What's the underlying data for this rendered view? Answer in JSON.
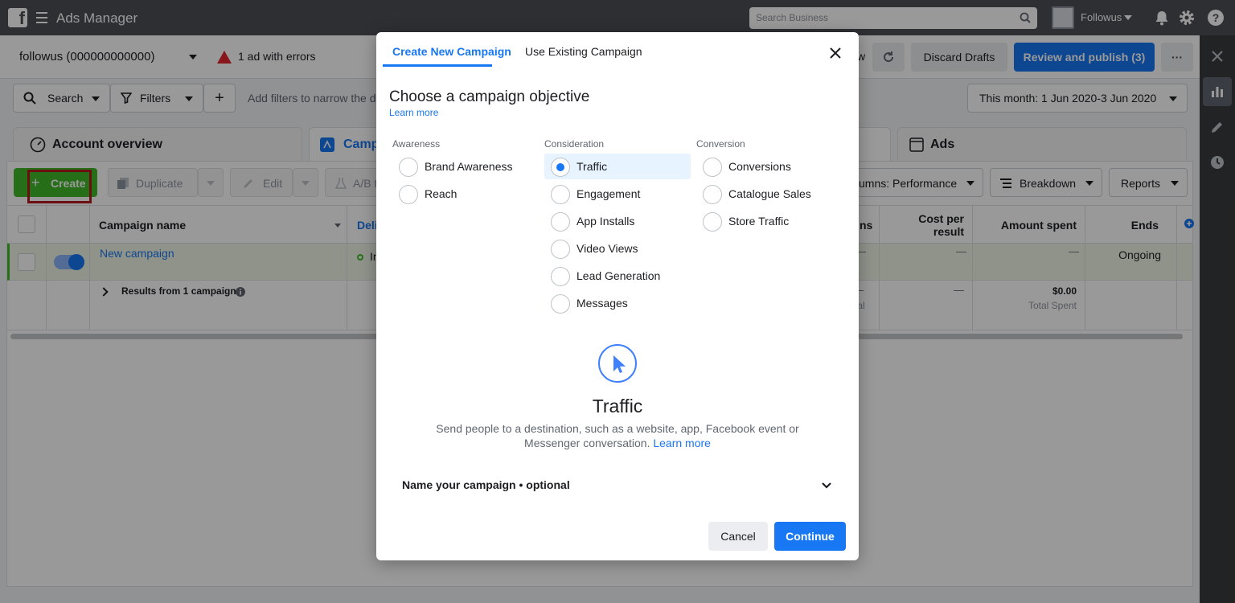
{
  "topbar": {
    "app_title": "Ads Manager",
    "search_placeholder": "Search Business",
    "business_name": "Followus"
  },
  "account": {
    "name": "followus (000000000000)",
    "error_text": "1 ad with errors",
    "partial_label": "w",
    "discard_label": "Discard Drafts",
    "review_label": "Review and publish (3)",
    "more_label": "···"
  },
  "filters": {
    "search_label": "Search",
    "filters_label": "Filters",
    "hint": "Add filters to narrow the da",
    "date_range": "This month: 1 Jun 2020-3 Jun 2020"
  },
  "tabs": {
    "overview": "Account overview",
    "campaigns": "Campa",
    "ads": "Ads"
  },
  "toolbar": {
    "create": "Create",
    "duplicate": "Duplicate",
    "edit": "Edit",
    "ab": "A/B t",
    "columns": "umns: Performance",
    "breakdown": "Breakdown",
    "reports": "Reports"
  },
  "table": {
    "headers": {
      "campaign_name": "Campaign name",
      "delivery": "Deli",
      "results_partial": "ns",
      "cost_per_result": "Cost per result",
      "amount_spent": "Amount spent",
      "ends": "Ends"
    },
    "campaign_row": {
      "name": "New campaign",
      "delivery": "In",
      "results": "—",
      "cost": "—",
      "spent": "—",
      "ends": "Ongoing"
    },
    "results_row": {
      "label": "Results from 1 campaign",
      "results": "—",
      "results_sub": "tal",
      "cost": "—",
      "spent": "$0.00",
      "spent_sub": "Total Spent"
    }
  },
  "modal": {
    "tab_new": "Create New Campaign",
    "tab_existing": "Use Existing Campaign",
    "heading": "Choose a campaign objective",
    "learn_more": "Learn more",
    "columns": [
      {
        "title": "Awareness",
        "options": [
          "Brand Awareness",
          "Reach"
        ]
      },
      {
        "title": "Consideration",
        "options": [
          "Traffic",
          "Engagement",
          "App Installs",
          "Video Views",
          "Lead Generation",
          "Messages"
        ]
      },
      {
        "title": "Conversion",
        "options": [
          "Conversions",
          "Catalogue Sales",
          "Store Traffic"
        ]
      }
    ],
    "selected": "Traffic",
    "objective_title": "Traffic",
    "objective_desc": "Send people to a destination, such as a website, app, Facebook event or Messenger conversation.",
    "objective_learn": "Learn more",
    "name_campaign": "Name your campaign • optional",
    "cancel": "Cancel",
    "continue": "Continue"
  },
  "colors": {
    "topbar": "#4b4f56",
    "accent": "#1877f2",
    "create_green": "#42b72a",
    "error_red": "#e4262c",
    "highlight_outline": "#b5191f"
  }
}
